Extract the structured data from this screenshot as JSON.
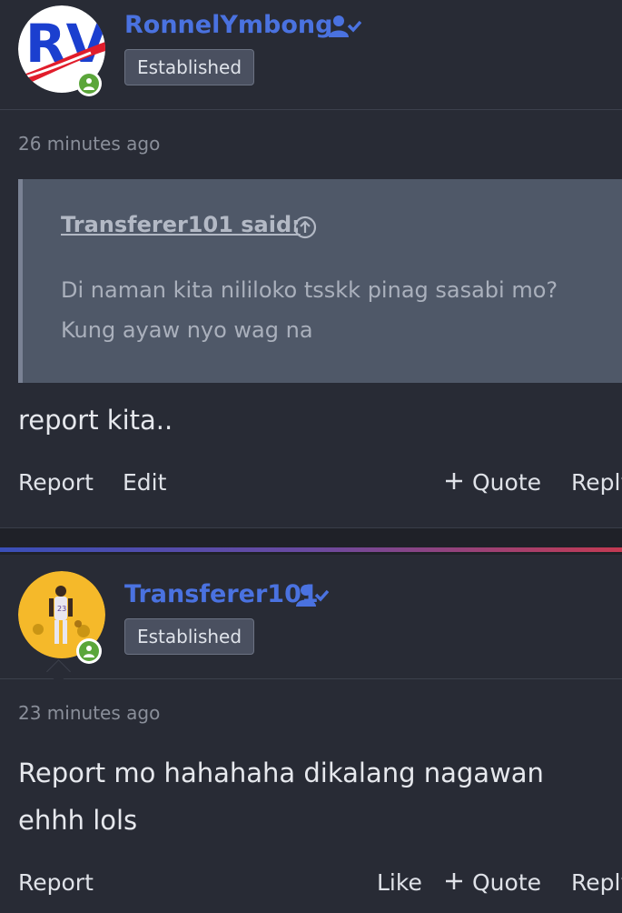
{
  "posts": [
    {
      "username": "RonnelYmbong",
      "badge": "Established",
      "timestamp": "26 minutes ago",
      "quote": {
        "author": "Transferer101 said:",
        "text": "Di naman kita nililoko tsskk pinag sasabi mo? Kung ayaw nyo wag na"
      },
      "message": "report kita..",
      "actions": {
        "report": "Report",
        "edit": "Edit",
        "quote": "Quote",
        "reply": "Reply"
      }
    },
    {
      "username": "Transferer101",
      "badge": "Established",
      "timestamp": "23 minutes ago",
      "message": "Report mo hahahaha dikalang nagawan ehhh lols",
      "actions": {
        "report": "Report",
        "like": "Like",
        "quote": "Quote",
        "reply": "Reply"
      }
    }
  ],
  "colors": {
    "background": "#1f2128",
    "post_background": "#282b35",
    "username": "#4a72e0",
    "quote_background": "#4f5868",
    "online": "#5ba63a"
  },
  "icons": [
    "user-check-icon",
    "online-user-icon",
    "arrow-up-circle-icon",
    "plus-icon"
  ]
}
